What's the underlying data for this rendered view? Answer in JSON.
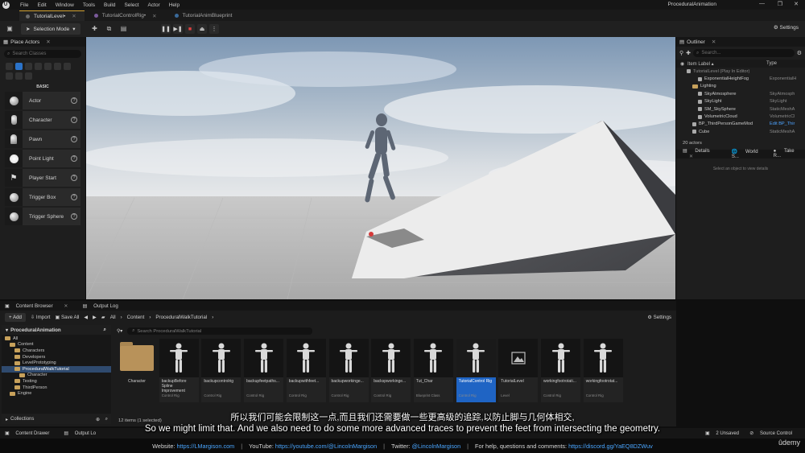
{
  "app": {
    "project_name": "ProceduralAnimation",
    "logo": "U"
  },
  "menu": [
    "File",
    "Edit",
    "Window",
    "Tools",
    "Build",
    "Select",
    "Actor",
    "Help"
  ],
  "window_controls": [
    "—",
    "❐",
    "✕"
  ],
  "doc_tabs": [
    {
      "label": "TutorialLevel•",
      "active": true
    },
    {
      "label": "TutorialControlRig•",
      "active": false
    },
    {
      "label": "TutorialAnimBlueprint",
      "active": false
    }
  ],
  "toolbar": {
    "selection_mode": "Selection Mode",
    "settings": "Settings"
  },
  "place_actors": {
    "tab": "Place Actors",
    "search_placeholder": "Search Classes",
    "section": "BASIC",
    "items": [
      "Actor",
      "Character",
      "Pawn",
      "Point Light",
      "Player Start",
      "Trigger Box",
      "Trigger Sphere"
    ]
  },
  "outliner": {
    "tab": "Outliner",
    "search_placeholder": "Search...",
    "col_label": "Item Label ▴",
    "col_type": "Type",
    "rows": [
      {
        "label": "TutorialLevel (Play In Editor)",
        "type": "",
        "indent": 1,
        "kind": "level"
      },
      {
        "label": "ExponentialHeightFog",
        "type": "ExponentialH",
        "indent": 3,
        "kind": "mesh"
      },
      {
        "label": "Lighting",
        "type": "",
        "indent": 2,
        "kind": "folder"
      },
      {
        "label": "SkyAtmosphere",
        "type": "SkyAtmosph",
        "indent": 3,
        "kind": "mesh"
      },
      {
        "label": "SkyLight",
        "type": "SkyLight",
        "indent": 3,
        "kind": "mesh"
      },
      {
        "label": "SM_SkySphere",
        "type": "StaticMeshA",
        "indent": 3,
        "kind": "mesh"
      },
      {
        "label": "VolumetricCloud",
        "type": "VolumetricCl",
        "indent": 3,
        "kind": "mesh"
      },
      {
        "label": "BP_ThirdPersonGameMod",
        "type": "Edit BP_Thir",
        "indent": 2,
        "kind": "mesh",
        "link": true
      },
      {
        "label": "Cube",
        "type": "StaticMeshA",
        "indent": 2,
        "kind": "mesh"
      }
    ],
    "actors_count": "20 actors"
  },
  "details": {
    "tabs": [
      "Details",
      "World S...",
      "Take R..."
    ],
    "empty_msg": "Select an object to view details"
  },
  "content_browser": {
    "tabs": [
      "Content Browser",
      "Output Log"
    ],
    "add": "+ Add",
    "import": "Import",
    "save_all": "Save All",
    "breadcrumb": [
      "All",
      "Content",
      "ProceduralWalkTutorial"
    ],
    "settings": "Settings",
    "sources_title": "ProceduralAnimation",
    "tree": [
      {
        "label": "All",
        "indent": 0
      },
      {
        "label": "Content",
        "indent": 1
      },
      {
        "label": "Characters",
        "indent": 2
      },
      {
        "label": "Developers",
        "indent": 2
      },
      {
        "label": "LevelPrototyping",
        "indent": 2
      },
      {
        "label": "ProceduralWalkTutorial",
        "indent": 2,
        "selected": true
      },
      {
        "label": "Character",
        "indent": 3
      },
      {
        "label": "Testing",
        "indent": 2
      },
      {
        "label": "ThirdPerson",
        "indent": 2
      },
      {
        "label": "Engine",
        "indent": 1
      }
    ],
    "collections": "Collections",
    "search_placeholder": "Search ProceduralWalkTutorial",
    "assets": [
      {
        "label": "Character",
        "kind": "",
        "type": "folder"
      },
      {
        "label": "backupBefore Spline Improvement",
        "kind": "Control Rig",
        "type": "rig"
      },
      {
        "label": "backupcontrolrig",
        "kind": "Control Rig",
        "type": "rig"
      },
      {
        "label": "backupfeetpaths...",
        "kind": "Control Rig",
        "type": "rig"
      },
      {
        "label": "backupwithfeet...",
        "kind": "Control Rig",
        "type": "rig"
      },
      {
        "label": "backupworkinge...",
        "kind": "Control Rig",
        "type": "rig"
      },
      {
        "label": "backspworkinge...",
        "kind": "Control Rig",
        "type": "rig"
      },
      {
        "label": "Tut_Char",
        "kind": "Blueprint Class",
        "type": "char"
      },
      {
        "label": "TutorialControl Rig",
        "kind": "Control Rig",
        "type": "rig",
        "selected": true
      },
      {
        "label": "TutorialLevel",
        "kind": "Level",
        "type": "level"
      },
      {
        "label": "workingfootrotati...",
        "kind": "Control Rig",
        "type": "rig"
      },
      {
        "label": "workingfootrotat...",
        "kind": "Control Rig",
        "type": "rig"
      }
    ],
    "items_count": "12 items (1 selected)"
  },
  "statusbar": {
    "left": [
      "Content Drawer",
      "Output Lo"
    ],
    "right": [
      "2 Unsaved",
      "Source Control"
    ]
  },
  "subtitles": {
    "cn": "所以我们可能会限制这一点,而且我们还需要做一些更高级的追踪,以防止脚与几何体相交,",
    "en": "So we might limit that. And we also need to do some more advanced traces to prevent the feet from intersecting the geometry."
  },
  "footer": {
    "website_label": "Website:",
    "website": "https://LMargison.com",
    "youtube_label": "YouTube:",
    "youtube": "https://youtube.com/@LincolnMargison",
    "twitter_label": "Twitter:",
    "twitter": "@LincolnMargison",
    "help_label": "For help, questions and comments:",
    "discord": "https://discord.gg/YaEQ8DZWuv",
    "brand": "ûdemy"
  }
}
